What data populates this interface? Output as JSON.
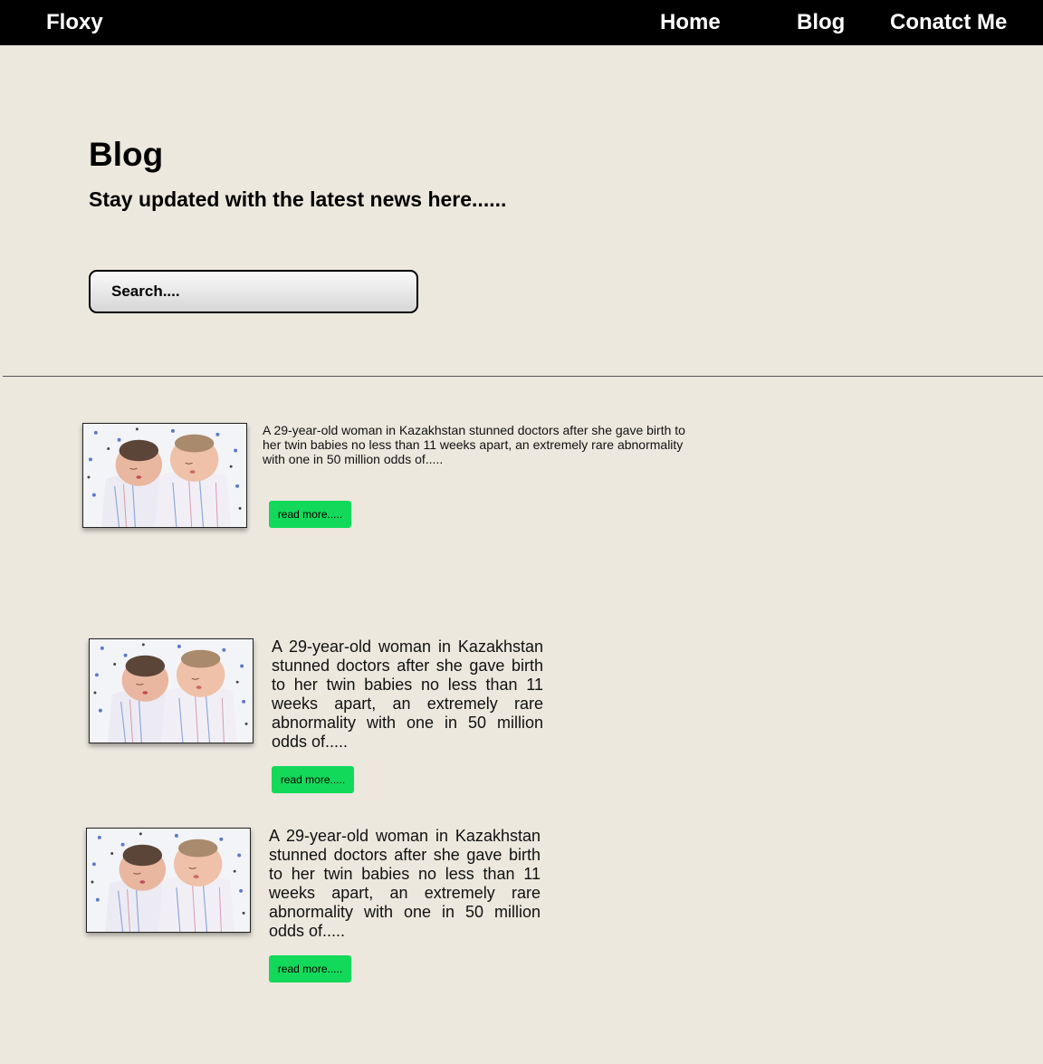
{
  "nav": {
    "brand": "Floxy",
    "links": [
      {
        "label": "Home"
      },
      {
        "label": "Blog"
      },
      {
        "label": "Conatct Me"
      }
    ]
  },
  "hero": {
    "title": "Blog",
    "subtitle": "Stay updated with the latest news here......",
    "search": {
      "placeholder": "Search....",
      "value": ""
    }
  },
  "posts": [
    {
      "excerpt": "A 29-year-old woman in Kazakhstan stunned doctors after she gave birth to her twin babies no less than 11 weeks apart, an extremely rare abnormality with one in 50 million odds of.....",
      "read_more_label": "read more....."
    },
    {
      "excerpt": "A 29-year-old woman in Kazakhstan stunned doctors after she gave birth to her twin babies no less than 11 weeks apart, an extremely rare abnormality with one in 50 million odds of.....",
      "read_more_label": "read more....."
    },
    {
      "excerpt": "A 29-year-old woman in Kazakhstan stunned doctors after she gave birth to her twin babies no less than 11 weeks apart, an extremely rare abnormality with one in 50 million odds of.....",
      "read_more_label": "read more....."
    }
  ],
  "colors": {
    "navbar": "#000000",
    "page_background": "#ece8de",
    "read_more_button": "#13d95a"
  }
}
